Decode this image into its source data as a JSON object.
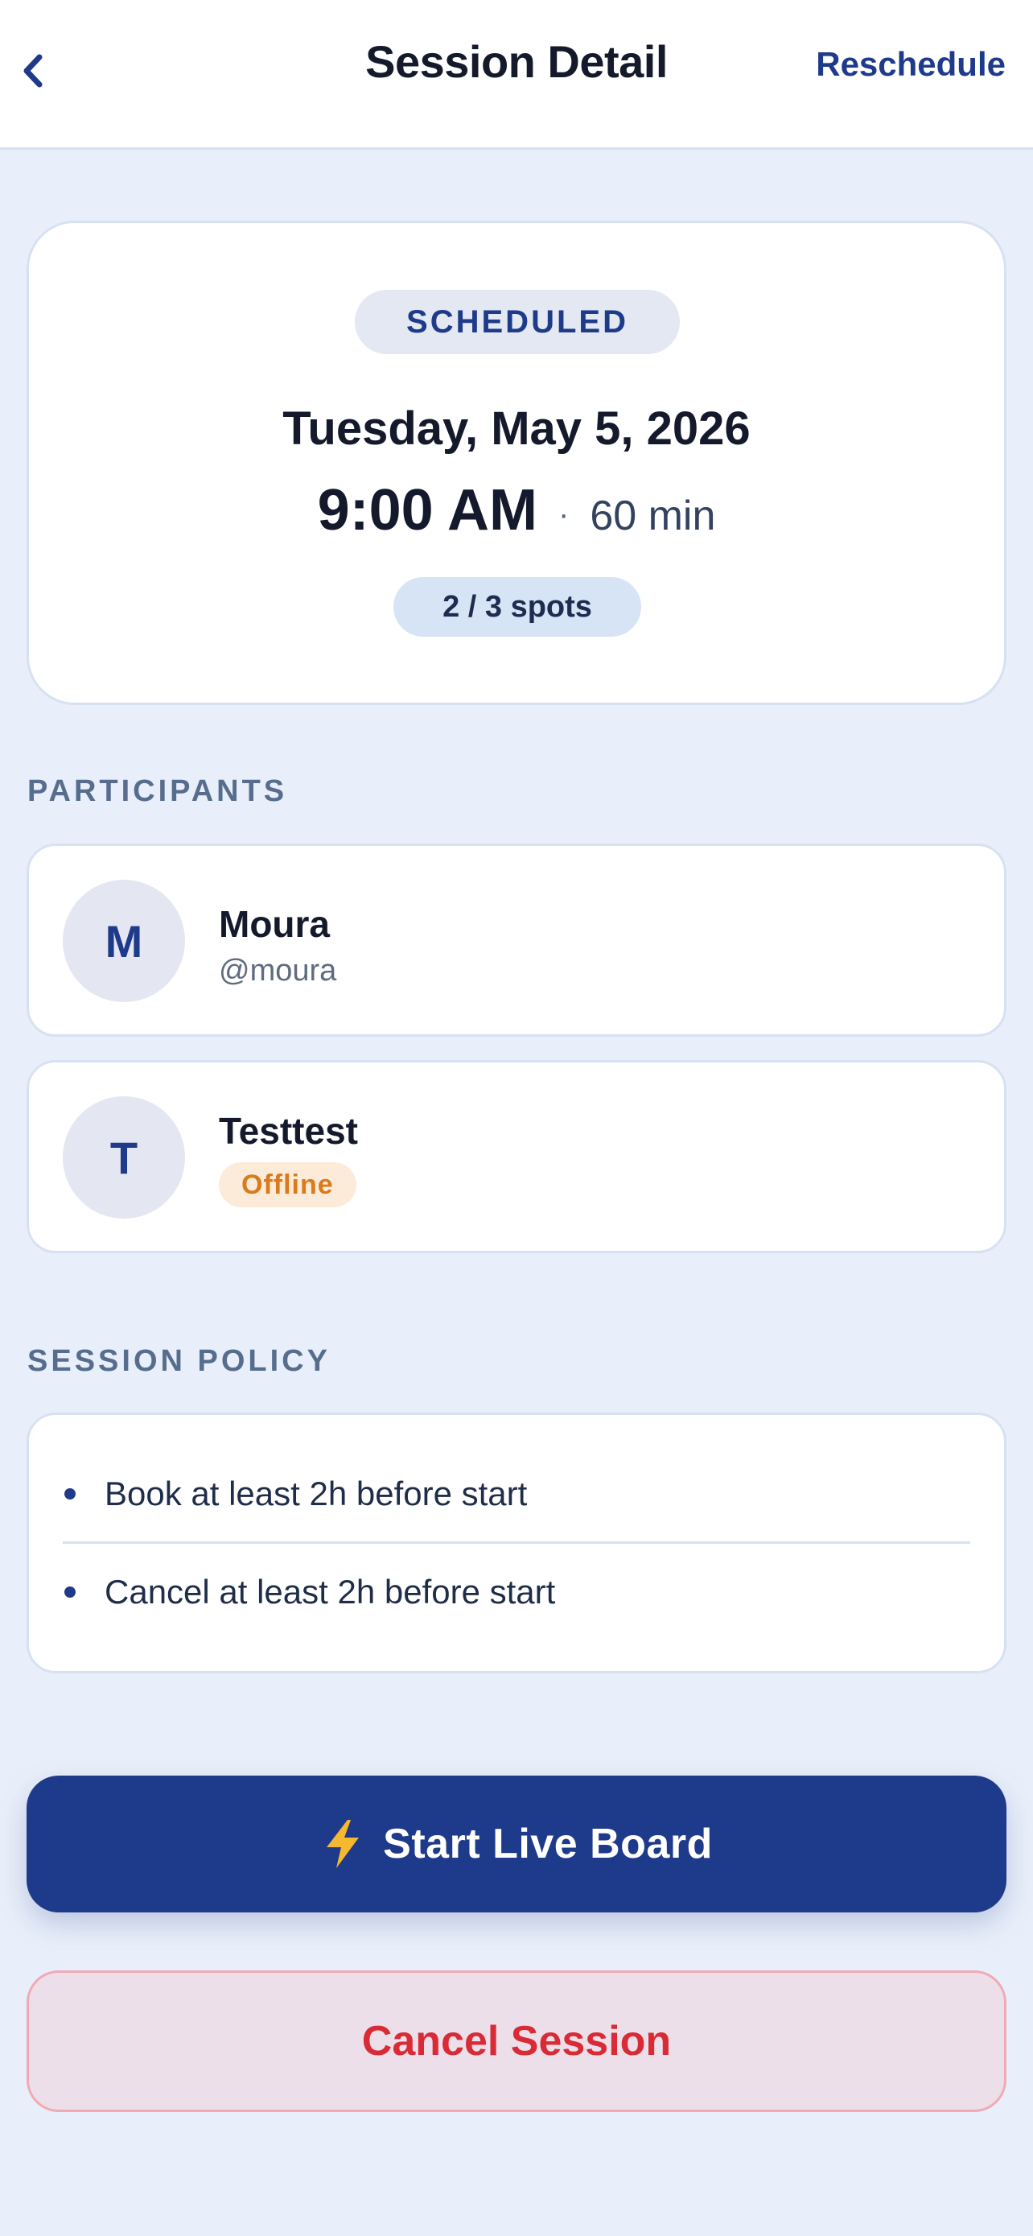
{
  "header": {
    "back_icon": "chevron-left-icon",
    "title": "Session Detail",
    "action_label": "Reschedule"
  },
  "session": {
    "status": "SCHEDULED",
    "date": "Tuesday, May 5, 2026",
    "time": "9:00 AM",
    "separator": "·",
    "duration": "60 min",
    "spots": "2 / 3 spots"
  },
  "participants": {
    "section_label": "PARTICIPANTS",
    "items": [
      {
        "initial": "M",
        "name": "Moura",
        "handle": "@moura"
      },
      {
        "initial": "T",
        "name": "Testtest",
        "status": "Offline"
      }
    ]
  },
  "policy": {
    "section_label": "SESSION POLICY",
    "items": [
      "Book at least 2h before start",
      "Cancel at least 2h before start"
    ]
  },
  "actions": {
    "start_icon": "lightning-bolt-icon",
    "start_label": "Start Live Board",
    "cancel_label": "Cancel Session"
  },
  "colors": {
    "background": "#e9effa",
    "primary": "#1e3a8a",
    "danger": "#d92b36",
    "offline": "#d97a1c",
    "bolt": "#f5b82e"
  }
}
